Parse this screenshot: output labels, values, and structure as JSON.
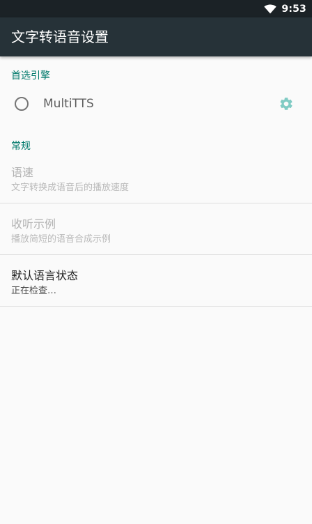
{
  "status_bar": {
    "time": "9:53",
    "wifi_icon": "wifi-icon"
  },
  "app_bar": {
    "title": "文字转语音设置"
  },
  "preferred_engine": {
    "header": "首选引擎",
    "engine": {
      "label": "MultiTTS",
      "selected": false,
      "settings_icon": "gear-icon"
    }
  },
  "general": {
    "header": "常规",
    "items": [
      {
        "title": "语速",
        "summary": "文字转换成语音后的播放速度",
        "enabled": false
      },
      {
        "title": "收听示例",
        "summary": "播放简短的语音合成示例",
        "enabled": false
      },
      {
        "title": "默认语言状态",
        "summary": "正在检查…",
        "enabled": true
      }
    ]
  },
  "colors": {
    "status_bar": "#1b2226",
    "app_bar": "#263238",
    "accent": "#00796b",
    "gear": "#80cbc4",
    "background": "#fafafa"
  }
}
